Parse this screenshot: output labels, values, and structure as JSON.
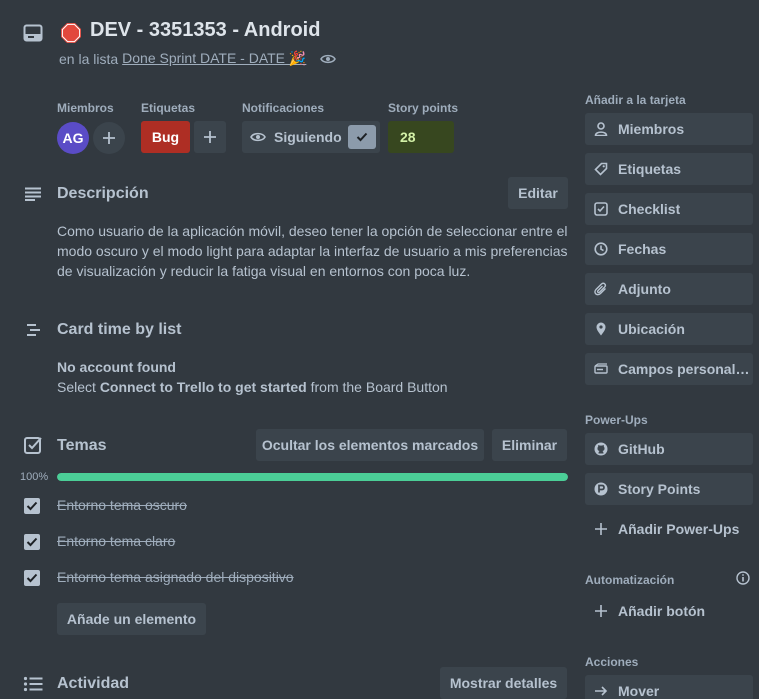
{
  "card": {
    "title": "DEV - 3351353 - Android",
    "list_prefix": "en la lista",
    "list_name": "Done Sprint DATE - DATE 🎉"
  },
  "meta": {
    "members_label": "Miembros",
    "member_initials": "AG",
    "labels_label": "Etiquetas",
    "label_bug": "Bug",
    "notifications_label": "Notificaciones",
    "watching": "Siguiendo",
    "story_points_label": "Story points",
    "story_points_value": "28"
  },
  "description": {
    "title": "Descripción",
    "edit": "Editar",
    "text": "Como usuario de la aplicación móvil, deseo tener la opción de seleccionar entre el modo oscuro y el modo light para adaptar la interfaz de usuario a mis preferencias de visualización y reducir la fatiga visual en entornos con poca luz."
  },
  "card_time": {
    "title": "Card time by list",
    "no_account": "No account found",
    "select_prefix": "Select",
    "connect": "Connect to Trello to get started",
    "select_suffix": "from the Board Button"
  },
  "checklist": {
    "title": "Temas",
    "hide_checked": "Ocultar los elementos marcados",
    "delete": "Eliminar",
    "percent_label": "100%",
    "progress": 1.0,
    "items": [
      {
        "text": "Entorno tema oscuro",
        "checked": true
      },
      {
        "text": "Entorno tema claro",
        "checked": true
      },
      {
        "text": "Entorno tema asignado del dispositivo",
        "checked": true
      }
    ],
    "add_item": "Añade un elemento"
  },
  "activity": {
    "title": "Actividad",
    "show_details": "Mostrar detalles"
  },
  "sidebar": {
    "add_to_card_label": "Añadir a la tarjeta",
    "add_items": [
      {
        "label": "Miembros",
        "icon": "person-icon"
      },
      {
        "label": "Etiquetas",
        "icon": "tag-icon"
      },
      {
        "label": "Checklist",
        "icon": "checklist-icon"
      },
      {
        "label": "Fechas",
        "icon": "clock-icon"
      },
      {
        "label": "Adjunto",
        "icon": "paperclip-icon"
      },
      {
        "label": "Ubicación",
        "icon": "location-pin-icon"
      },
      {
        "label": "Campos personaliz...",
        "icon": "custom-fields-icon"
      }
    ],
    "powerups_label": "Power-Ups",
    "powerups": [
      {
        "label": "GitHub",
        "icon": "github-icon"
      },
      {
        "label": "Story Points",
        "icon": "story-points-icon"
      }
    ],
    "add_powerups": "Añadir Power-Ups",
    "automation_label": "Automatización",
    "add_button": "Añadir botón",
    "actions_label": "Acciones",
    "move": "Mover"
  },
  "colors": {
    "background": "#323940",
    "button": "#3b444c",
    "bug_label": "#ae2e24",
    "avatar": "#5a4cc6",
    "progress": "#4bce97",
    "story_points_bg": "#37471f",
    "stop_icon": "#e2483d"
  }
}
